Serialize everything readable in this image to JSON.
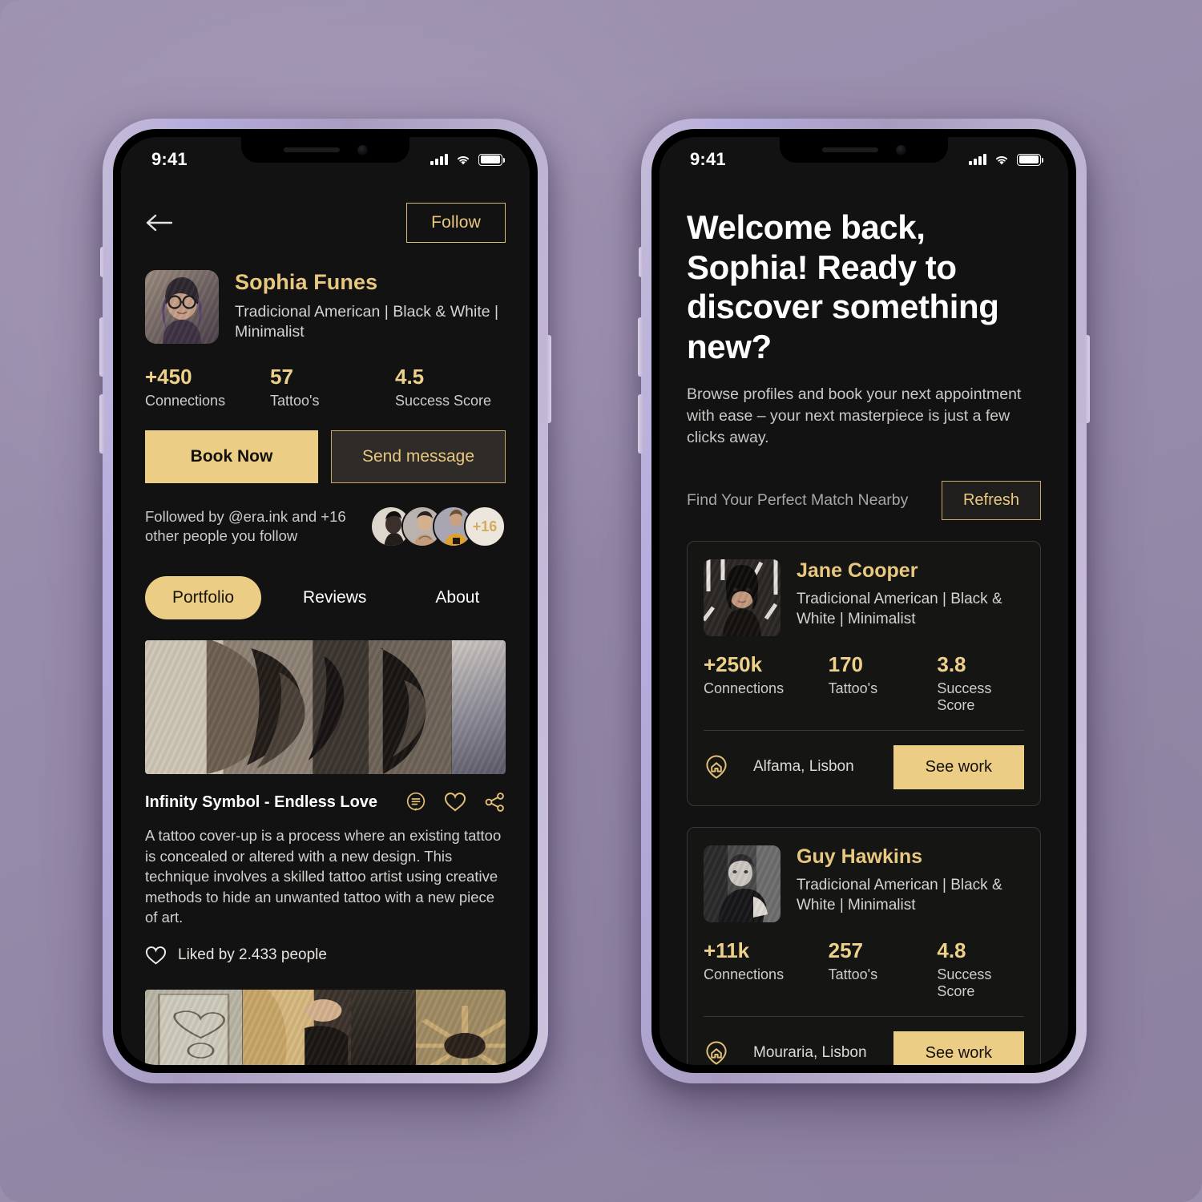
{
  "theme": {
    "accent_gold": "#e8c87e",
    "button_gold": "#ebcd86",
    "screen_bg": "#121212",
    "page_bg": "#9a8fab"
  },
  "status_bar": {
    "time": "9:41"
  },
  "left_phone": {
    "header": {
      "back_icon": "arrow-left-icon",
      "follow_label": "Follow"
    },
    "profile": {
      "name": "Sophia Funes",
      "tags": "Tradicional American | Black & White | Minimalist",
      "stats": [
        {
          "value": "+450",
          "label": "Connections"
        },
        {
          "value": "57",
          "label": "Tattoo's"
        },
        {
          "value": "4.5",
          "label": "Success Score"
        }
      ],
      "book_label": "Book Now",
      "message_label": "Send message",
      "followed_text": "Followed by @era.ink and +16 other people you follow",
      "avatar_more": "+16"
    },
    "tabs": [
      {
        "label": "Portfolio",
        "active": true
      },
      {
        "label": "Reviews",
        "active": false
      },
      {
        "label": "About",
        "active": false
      }
    ],
    "portfolio": {
      "title": "Infinity Symbol - Endless Love",
      "description": "A tattoo cover-up is a process where an existing tattoo is concealed or altered with a new design. This technique involves a skilled tattoo artist using creative methods to hide an unwanted tattoo with a new piece of art.",
      "liked_text": "Liked by 2.433 people",
      "icons": [
        "comment-icon",
        "heart-icon",
        "share-icon"
      ]
    }
  },
  "right_phone": {
    "welcome_title": "Welcome back, Sophia! Ready to discover something new?",
    "welcome_sub": "Browse profiles and book your next appointment with ease – your next masterpiece is just a few clicks away.",
    "match_label": "Find Your Perfect Match Nearby",
    "refresh_label": "Refresh",
    "cards": [
      {
        "name": "Jane Cooper",
        "tags": "Tradicional American | Black & White | Minimalist",
        "stats": [
          {
            "value": "+250k",
            "label": "Connections"
          },
          {
            "value": "170",
            "label": "Tattoo's"
          },
          {
            "value": "3.8",
            "label": "Success Score"
          }
        ],
        "location": "Alfama, Lisbon",
        "action_label": "See work"
      },
      {
        "name": "Guy Hawkins",
        "tags": "Tradicional American | Black & White | Minimalist",
        "stats": [
          {
            "value": "+11k",
            "label": "Connections"
          },
          {
            "value": "257",
            "label": "Tattoo's"
          },
          {
            "value": "4.8",
            "label": "Success Score"
          }
        ],
        "location": "Mouraria, Lisbon",
        "action_label": "See work"
      }
    ]
  }
}
